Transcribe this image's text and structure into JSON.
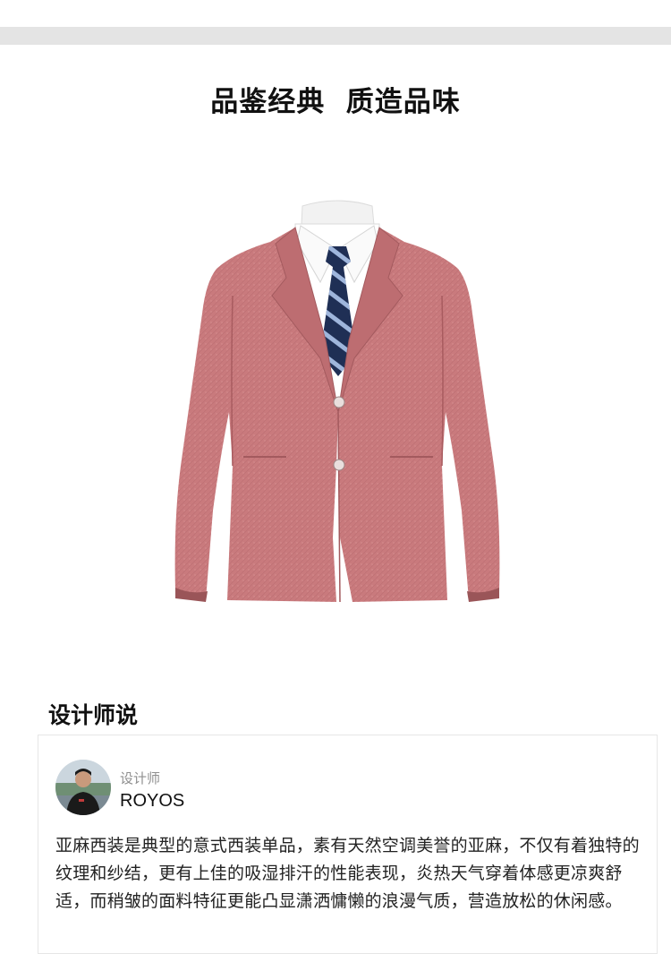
{
  "hero": {
    "title": "品鉴经典  质造品味",
    "image_icon": "blazer-on-mannequin-image"
  },
  "designer_section": {
    "title": "设计师说",
    "avatar_icon": "designer-avatar",
    "role": "设计师",
    "name": "ROYOS",
    "quote": "亚麻西装是典型的意式西装单品，素有天然空调美誉的亚麻，不仅有着独特的纹理和纱结，更有上佳的吸湿排汗的性能表现，炎热天气穿着体感更凉爽舒适，而稍皱的面料特征更能凸显潇洒慵懒的浪漫气质，营造放松的休闲感。"
  },
  "colors": {
    "blazer": "#c97a7d",
    "tie_navy": "#1f2f55",
    "tie_stripe": "#9fb6dc",
    "band": "#e4e4e4"
  }
}
